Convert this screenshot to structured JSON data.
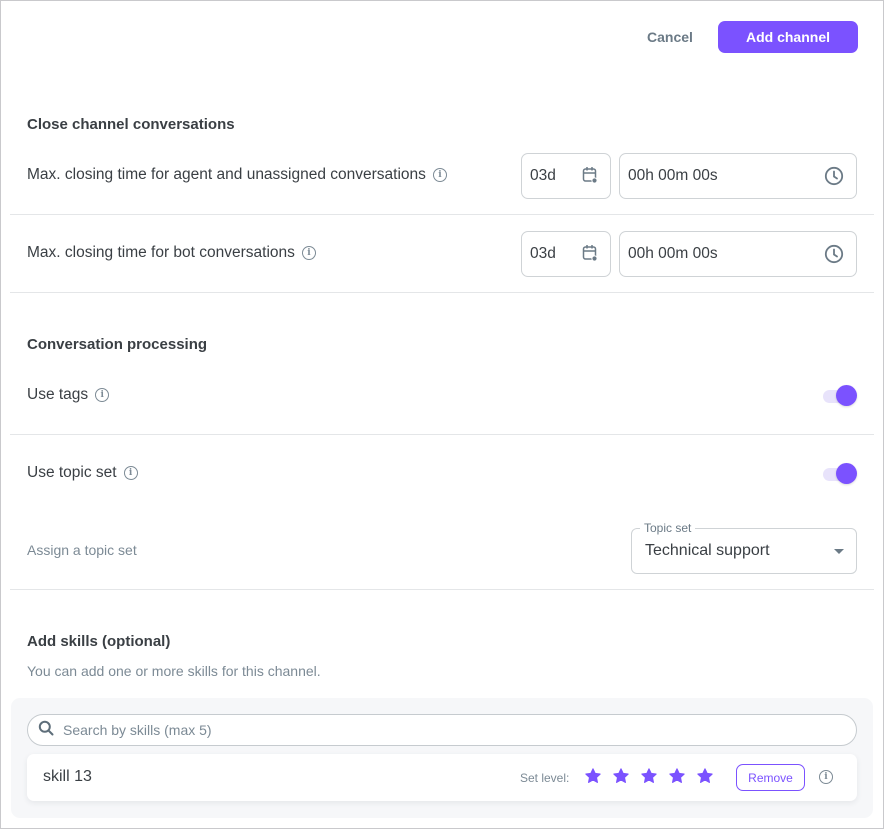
{
  "header": {
    "cancel_label": "Cancel",
    "primary_label": "Add channel"
  },
  "close_conversations": {
    "title": "Close channel conversations",
    "rows": [
      {
        "label": "Max. closing time for agent and unassigned conversations",
        "days_value": "03d",
        "time_value": "00h 00m 00s"
      },
      {
        "label": "Max. closing time for bot conversations",
        "days_value": "03d",
        "time_value": "00h 00m 00s"
      }
    ]
  },
  "processing": {
    "title": "Conversation processing",
    "use_tags": {
      "label": "Use tags",
      "enabled": true
    },
    "use_topic_set": {
      "label": "Use topic set",
      "enabled": true
    },
    "assign_label": "Assign a topic set",
    "topic_set": {
      "legend": "Topic set",
      "value": "Technical support"
    }
  },
  "skills": {
    "title": "Add skills (optional)",
    "subtitle": "You can add one or more skills for this channel.",
    "search_placeholder": "Search by skills (max 5)",
    "items": [
      {
        "name": "skill 13",
        "set_level_label": "Set level:",
        "level": 5,
        "max_level": 5,
        "remove_label": "Remove"
      }
    ]
  },
  "colors": {
    "accent": "#7b52ff",
    "toggle_track": "#e8e3fb",
    "text": "#3a3f44",
    "muted": "#7c8a95"
  }
}
